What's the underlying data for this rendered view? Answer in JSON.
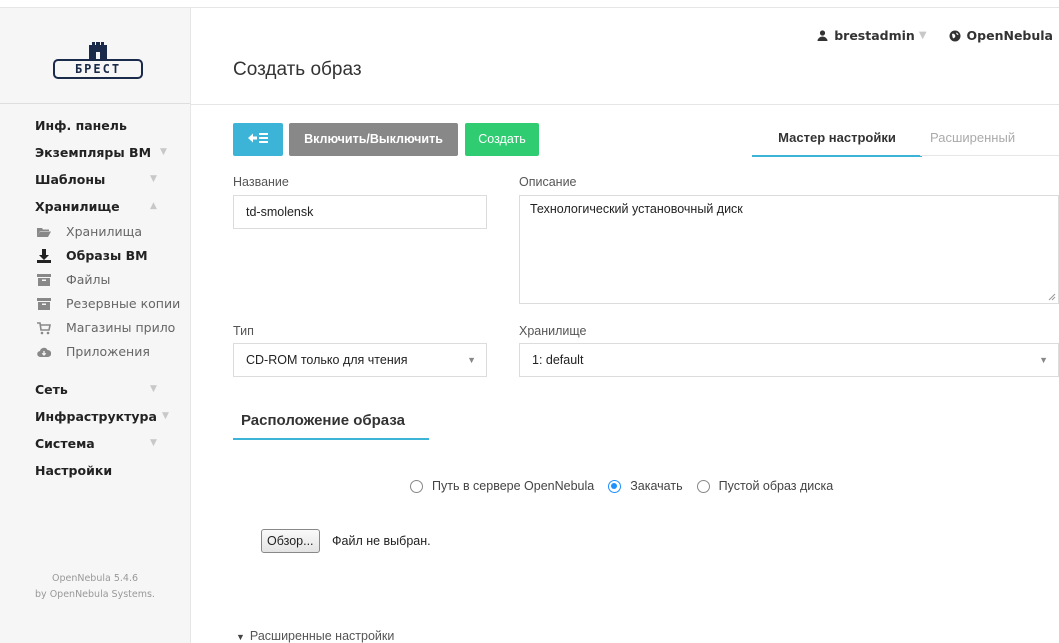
{
  "header": {
    "page_title": "Создать образ",
    "user": "brestadmin",
    "zone": "OpenNebula"
  },
  "logo": {
    "text": "БРЕСТ"
  },
  "sidebar": {
    "items": [
      {
        "label": "Инф. панель"
      },
      {
        "label": "Экземпляры ВМ"
      },
      {
        "label": "Шаблоны"
      },
      {
        "label": "Хранилище"
      },
      {
        "label": "Сеть"
      },
      {
        "label": "Инфраструктура"
      },
      {
        "label": "Система"
      },
      {
        "label": "Настройки"
      }
    ],
    "storage_subitems": [
      {
        "label": "Хранилища",
        "icon": "folder-open-icon"
      },
      {
        "label": "Образы ВМ",
        "icon": "download-icon",
        "active": true
      },
      {
        "label": "Файлы",
        "icon": "archive-icon"
      },
      {
        "label": "Резервные копии",
        "icon": "archive-icon"
      },
      {
        "label": "Магазины прило",
        "icon": "cart-icon"
      },
      {
        "label": "Приложения",
        "icon": "cloud-icon"
      }
    ],
    "footer_version": "OpenNebula 5.4.6",
    "footer_by": "by OpenNebula Systems."
  },
  "toolbar": {
    "toggle_label": "Включить/Выключить",
    "create_label": "Создать"
  },
  "tabs": {
    "wizard": "Мастер настройки",
    "advanced": "Расширенный"
  },
  "form": {
    "name_label": "Название",
    "name_value": "td-smolensk",
    "description_label": "Описание",
    "description_value": "Технологический установочный диск",
    "type_label": "Тип",
    "type_value": "CD-ROM только для чтения",
    "datastore_label": "Хранилище",
    "datastore_value": "1: default"
  },
  "location": {
    "title": "Расположение образа",
    "options": [
      {
        "label": "Путь в сервере OpenNebula",
        "selected": false
      },
      {
        "label": "Закачать",
        "selected": true
      },
      {
        "label": "Пустой образ диска",
        "selected": false
      }
    ],
    "browse_label": "Обзор...",
    "file_status": "Файл не выбран."
  },
  "advanced_settings": "Расширенные настройки",
  "colors": {
    "accent": "#3bb4d8",
    "create": "#2fcc71",
    "toggle": "#888888"
  }
}
